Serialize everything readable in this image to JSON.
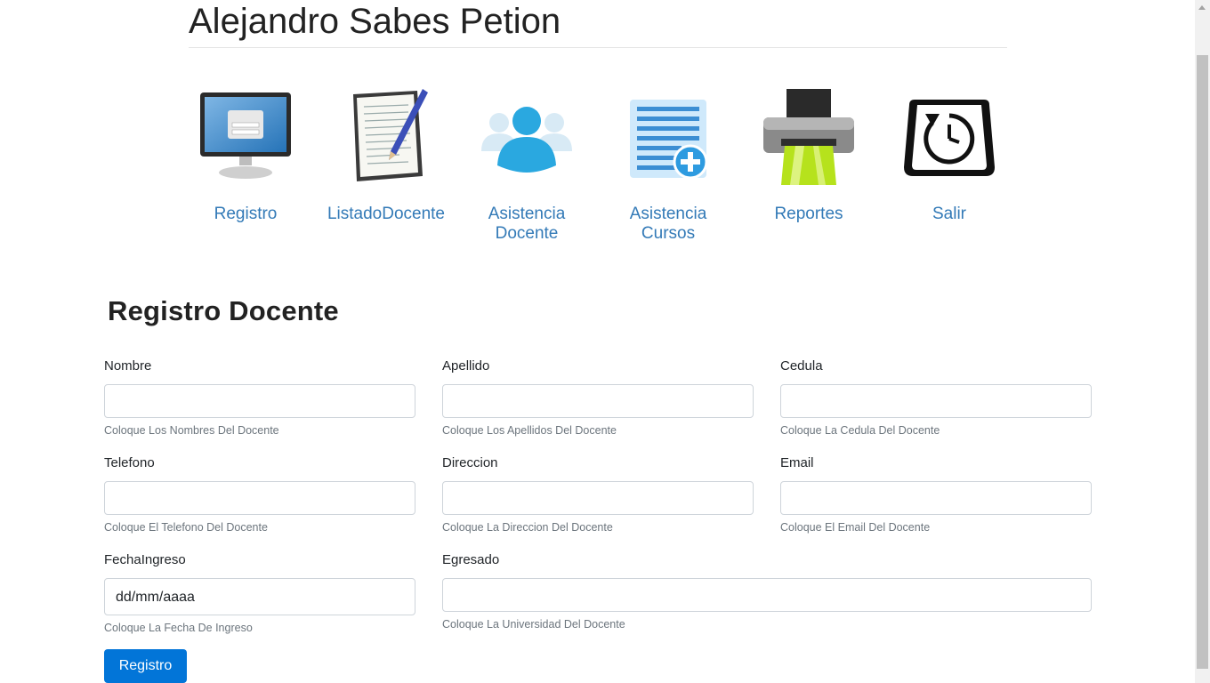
{
  "header": {
    "title": "Alejandro Sabes Petion"
  },
  "nav": [
    {
      "label": "Registro",
      "icon": "monitor-login-icon"
    },
    {
      "label": "ListadoDocente",
      "icon": "document-pen-icon"
    },
    {
      "label": "Asistencia Docente",
      "icon": "users-icon"
    },
    {
      "label": "Asistencia Cursos",
      "icon": "list-add-icon"
    },
    {
      "label": "Reportes",
      "icon": "printer-icon"
    },
    {
      "label": "Salir",
      "icon": "power-restart-icon"
    }
  ],
  "form": {
    "title": "Registro Docente",
    "fields": {
      "nombre": {
        "label": "Nombre",
        "value": "",
        "help": "Coloque Los Nombres Del Docente"
      },
      "apellido": {
        "label": "Apellido",
        "value": "",
        "help": "Coloque Los Apellidos Del Docente"
      },
      "cedula": {
        "label": "Cedula",
        "value": "",
        "help": "Coloque La Cedula Del Docente"
      },
      "telefono": {
        "label": "Telefono",
        "value": "",
        "help": "Coloque El Telefono Del Docente"
      },
      "direccion": {
        "label": "Direccion",
        "value": "",
        "help": "Coloque La Direccion Del Docente"
      },
      "email": {
        "label": "Email",
        "value": "",
        "help": "Coloque El Email Del Docente"
      },
      "fecha": {
        "label": "FechaIngreso",
        "value": "dd/mm/aaaa",
        "help": "Coloque La Fecha De Ingreso"
      },
      "egresado": {
        "label": "Egresado",
        "value": "",
        "help": "Coloque La Universidad Del Docente"
      }
    },
    "submit_label": "Registro"
  },
  "colors": {
    "link": "#337ab7",
    "primary": "#0275d8"
  }
}
